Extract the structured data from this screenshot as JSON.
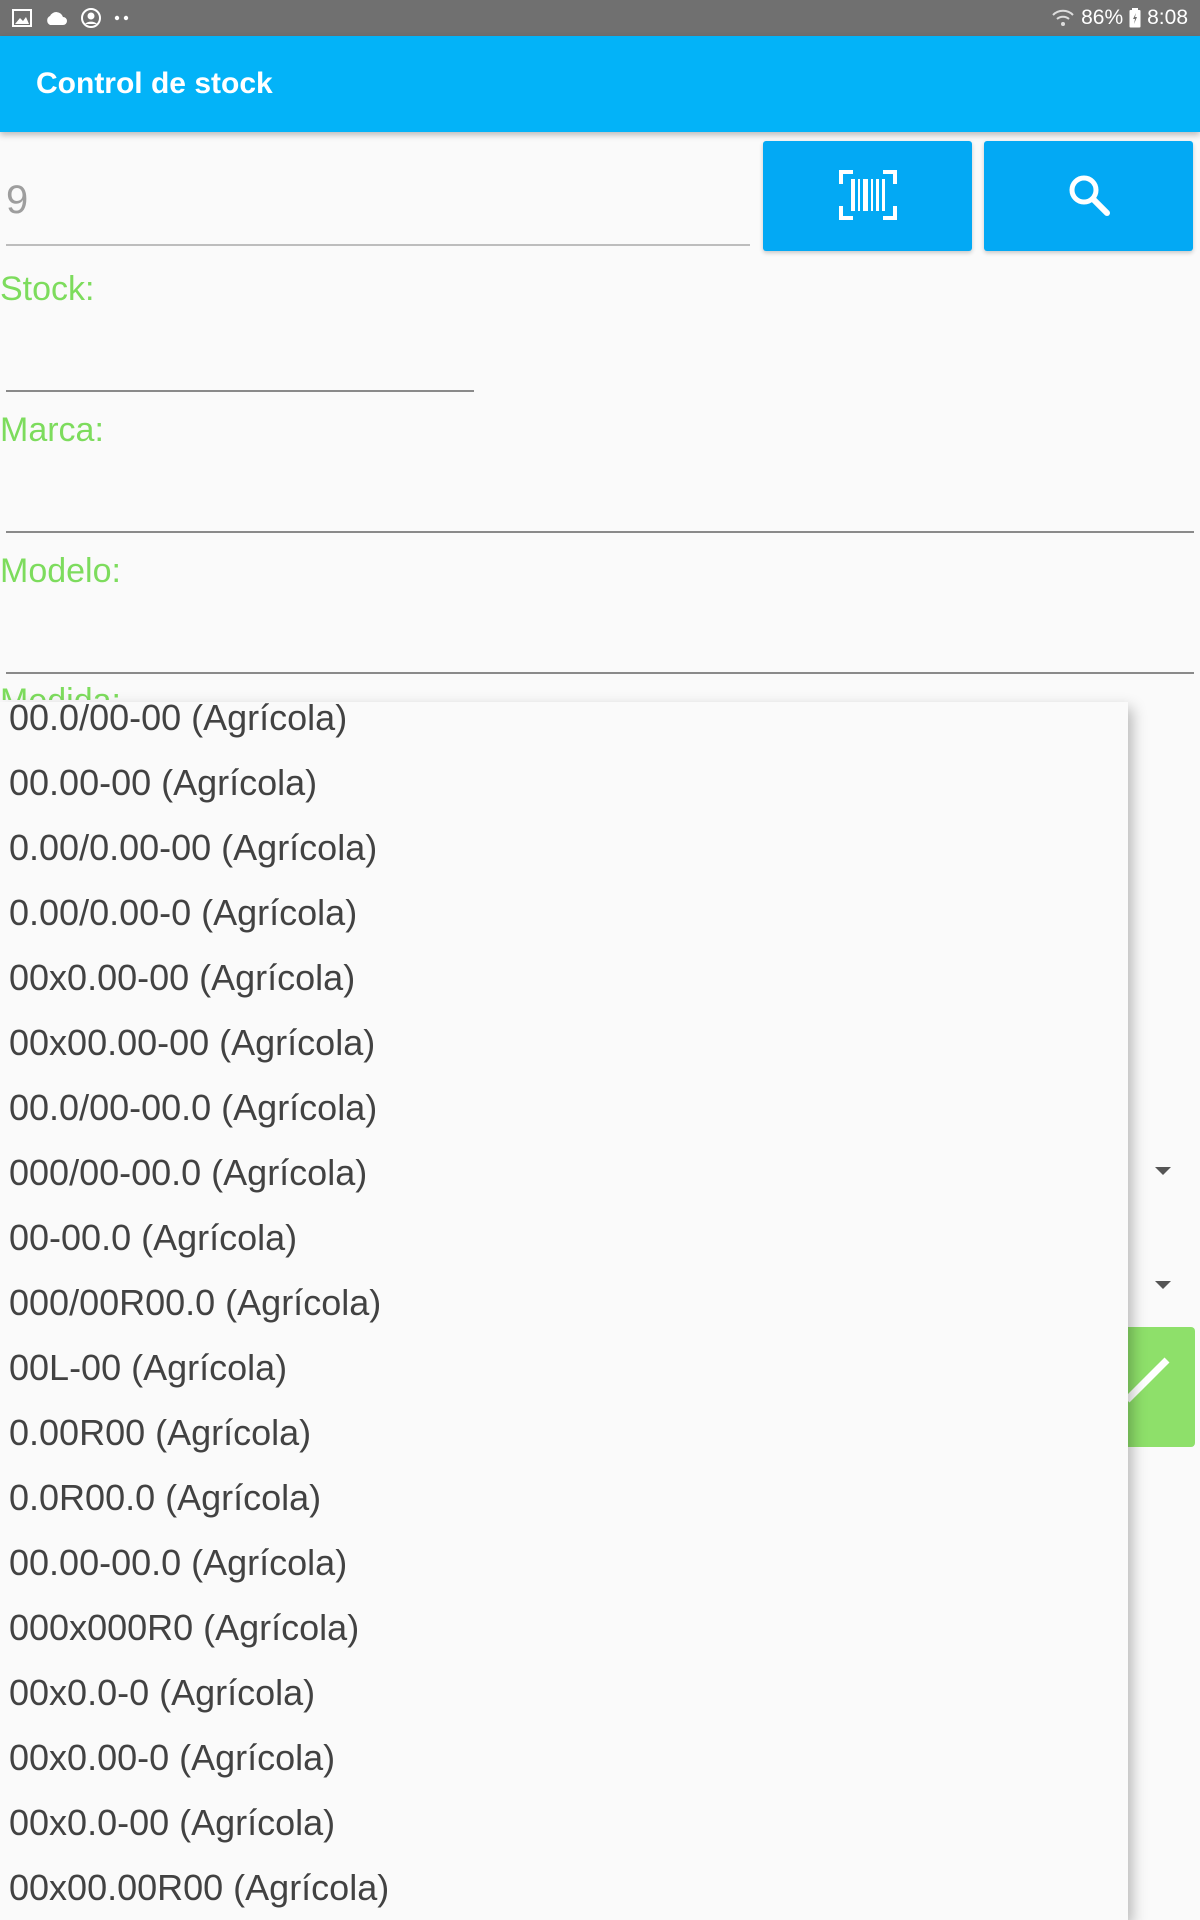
{
  "status_bar": {
    "battery": "86%",
    "time": "8:08",
    "icons": [
      "image-icon",
      "cloud-icon",
      "account-circle-icon",
      "more-dots-icon",
      "wifi-icon",
      "battery-icon"
    ]
  },
  "app_bar": {
    "title": "Control de stock"
  },
  "search": {
    "code_value": "9",
    "scan_icon": "barcode-icon",
    "search_icon": "search-icon"
  },
  "form": {
    "stock_label": "Stock:",
    "marca_label": "Marca:",
    "modelo_label": "Modelo:",
    "partial_label": "Medida:"
  },
  "colors": {
    "app_bar": "#03b3f8",
    "button": "#03a9f4",
    "label": "#7ddc5d",
    "fab": "#8ee06a"
  },
  "dropdown": {
    "items": [
      "00.0/00-00 (Agrícola)",
      "00.00-00 (Agrícola)",
      "0.00/0.00-00 (Agrícola)",
      "0.00/0.00-0 (Agrícola)",
      "00x0.00-00 (Agrícola)",
      "00x00.00-00 (Agrícola)",
      "00.0/00-00.0 (Agrícola)",
      "000/00-00.0 (Agrícola)",
      "00-00.0 (Agrícola)",
      "000/00R00.0 (Agrícola)",
      "00L-00 (Agrícola)",
      "0.00R00 (Agrícola)",
      "0.0R00.0 (Agrícola)",
      "00.00-00.0 (Agrícola)",
      "000x000R0 (Agrícola)",
      "00x0.0-0 (Agrícola)",
      "00x0.00-0 (Agrícola)",
      "00x0.0-00 (Agrícola)",
      "00x00.00R00 (Agrícola)"
    ]
  }
}
